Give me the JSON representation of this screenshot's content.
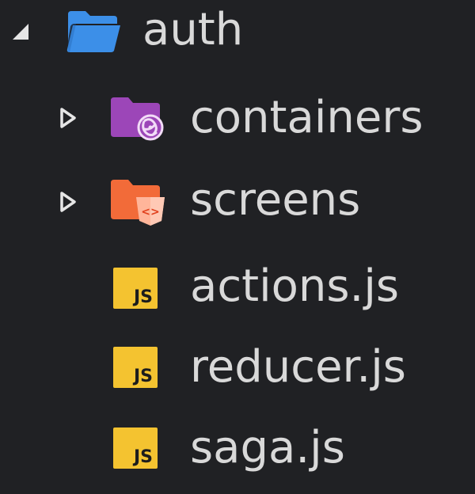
{
  "colors": {
    "background": "#202124",
    "text": "#d9d9d9",
    "arrow": "#e6e6e6",
    "folder_blue": "#3c8fe8",
    "folder_purple": "#9c46b8",
    "folder_orange": "#f26b39",
    "js_yellow": "#f4c330"
  },
  "tree": {
    "root": {
      "label": "auth",
      "icon": "folder-open-icon",
      "expanded": true
    },
    "children": [
      {
        "label": "containers",
        "icon": "redux-folder-icon",
        "type": "folder",
        "expanded": false
      },
      {
        "label": "screens",
        "icon": "html-folder-icon",
        "type": "folder",
        "expanded": false
      },
      {
        "label": "actions.js",
        "icon": "js-file-icon",
        "type": "file",
        "badge": "JS"
      },
      {
        "label": "reducer.js",
        "icon": "js-file-icon",
        "type": "file",
        "badge": "JS"
      },
      {
        "label": "saga.js",
        "icon": "js-file-icon",
        "type": "file",
        "badge": "JS"
      }
    ]
  }
}
